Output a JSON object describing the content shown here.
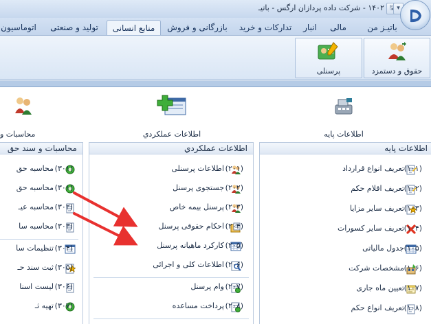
{
  "window": {
    "title": "۱۴۰۲ - شرکت داده پردازان ارگس - باتیـ",
    "quick_access": [
      "▾",
      "↩",
      "🖫"
    ]
  },
  "tabs": [
    {
      "label": "باتیـز من",
      "active": false
    },
    {
      "label": "مالی",
      "active": false
    },
    {
      "label": "انبار",
      "active": false
    },
    {
      "label": "تدارکات و خرید",
      "active": false
    },
    {
      "label": "بازرگانی و فروش",
      "active": false
    },
    {
      "label": "منابع انسانی",
      "active": true
    },
    {
      "label": "تولید و صنعتی",
      "active": false
    },
    {
      "label": "اتوماسیون",
      "active": false
    }
  ],
  "ribbon": {
    "buttons": [
      {
        "label": "حقوق و دستمزد",
        "icon": "payroll-users-icon"
      },
      {
        "label": "پرسنلی",
        "icon": "personnel-card-icon"
      }
    ]
  },
  "toolbar": {
    "base_info": "اطلاعات پایه",
    "performance_info": "اطلاعات عملکردي",
    "accounting": "محاسبات و"
  },
  "panels": {
    "base": {
      "title": "اطلاعات پایه",
      "items": [
        {
          "code": "(۱۰۱)",
          "label": "تعریف انواع قرارداد",
          "icon": "edit-document-icon"
        },
        {
          "code": "(۱۰۲)",
          "label": "تعریف اقلام حکم",
          "icon": "edit-document-icon"
        },
        {
          "code": "(۱۰۳)",
          "label": "تعریف سایر مزایا",
          "icon": "star-document-icon"
        },
        {
          "code": "(۱۰۴)",
          "label": "تعریف سایر کسورات",
          "icon": "red-x-icon"
        },
        {
          "code": "(۱۰۵)",
          "label": "جدول مالیاتی",
          "icon": "table-icon"
        },
        {
          "code": "(۱۰۶)",
          "label": "مشخصات شرکت",
          "icon": "company-icon"
        },
        {
          "code": "(۱۰۷)",
          "label": "تعیین ماه جاری",
          "icon": "calendar-note-icon"
        },
        {
          "code": "(۱۰۸)",
          "label": "تعریف انواع حکم",
          "icon": "document-icon"
        }
      ]
    },
    "performance": {
      "title": "اطلاعات عملکردي",
      "items": [
        {
          "code": "(۲۰۱)",
          "label": "اطلاعات پرسنلی",
          "icon": "users-icon"
        },
        {
          "code": "(۲۰۲)",
          "label": "جستجوی پرسنل",
          "icon": "users-icon"
        },
        {
          "code": "(۲۰۳)",
          "label": "پرسنل بیمه خاص",
          "icon": "users-icon"
        },
        {
          "code": "(۲۰۴)",
          "label": "احکام حقوقی پرسنل",
          "icon": "folder-document-icon"
        },
        {
          "code": "(۲۰۵)",
          "label": "کارکرد ماهیانه پرسنل",
          "icon": "grid-table-icon"
        },
        {
          "code": "(۲۰۶)",
          "label": "اطلاعات کلی و اجرائی",
          "icon": "search-document-icon"
        },
        {
          "code": "(۲۰۷)",
          "label": "وام پرسنل",
          "icon": "loan-document-icon"
        },
        {
          "code": "(۲۰۸)",
          "label": "پرداخت مساعده",
          "icon": "advance-payment-icon"
        }
      ]
    },
    "accounting": {
      "title": "محاسبات و سند حق",
      "items": [
        {
          "code": "(۳۰۱)",
          "label": "محاسبه حق",
          "icon": "money-gear-icon"
        },
        {
          "code": "(۳۰۱)",
          "label": "محاسبه حق",
          "icon": "money-gear-icon"
        },
        {
          "code": "(۳۰۲)",
          "label": "محاسبه عیـ",
          "icon": "document-icon"
        },
        {
          "code": "(۳۰۳)",
          "label": "محاسبه سا",
          "icon": "document-icon"
        },
        {
          "code": "(۳۰۴)",
          "label": "تنظیمات سا",
          "icon": "window-icon"
        },
        {
          "code": "(۳۰۵)",
          "label": "ثبت سند حـ",
          "icon": "star-document-icon"
        },
        {
          "code": "(۳۰۶)",
          "label": "لیست اسنا",
          "icon": "document-icon"
        },
        {
          "code": "(۳۰۷)",
          "label": "تهیه ثـ",
          "icon": "money-gear-icon"
        }
      ]
    }
  },
  "annotation_arrows": {
    "color": "#e8312f",
    "count": 2
  }
}
